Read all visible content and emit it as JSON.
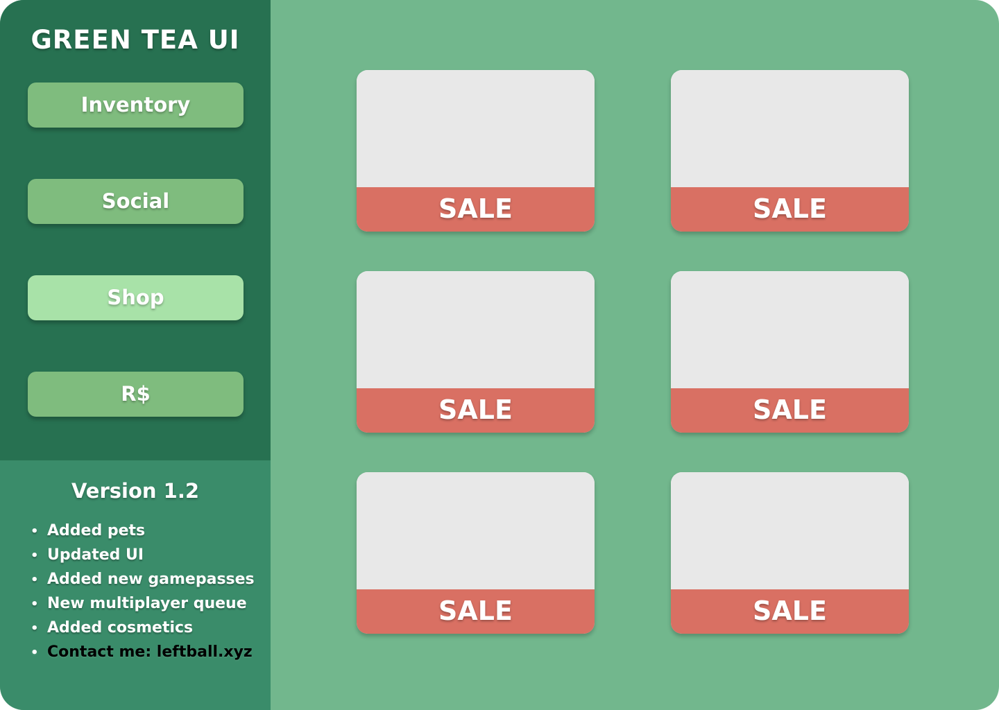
{
  "app": {
    "title": "GREEN TEA UI"
  },
  "sidebar": {
    "items": [
      {
        "label": "Inventory",
        "active": false
      },
      {
        "label": "Social",
        "active": false
      },
      {
        "label": "Shop",
        "active": true
      },
      {
        "label": "R$",
        "active": false
      }
    ]
  },
  "changelog": {
    "version": "Version 1.2",
    "bullet": "•",
    "items": [
      "Added pets",
      "Updated UI",
      "Added new gamepasses",
      "New multiplayer queue",
      "Added cosmetics",
      "Contact me: leftball.xyz"
    ]
  },
  "shop": {
    "cards": [
      {
        "banner": "SALE"
      },
      {
        "banner": "SALE"
      },
      {
        "banner": "SALE"
      },
      {
        "banner": "SALE"
      },
      {
        "banner": "SALE"
      },
      {
        "banner": "SALE"
      }
    ]
  },
  "colors": {
    "background": "#72b78d",
    "sidebar": "#277151",
    "changelog_panel": "#3a8c6a",
    "nav_button": "#7fbc7e",
    "nav_button_active": "#a8e2a8",
    "card": "#e8e8e8",
    "sale_banner": "#d97063"
  }
}
